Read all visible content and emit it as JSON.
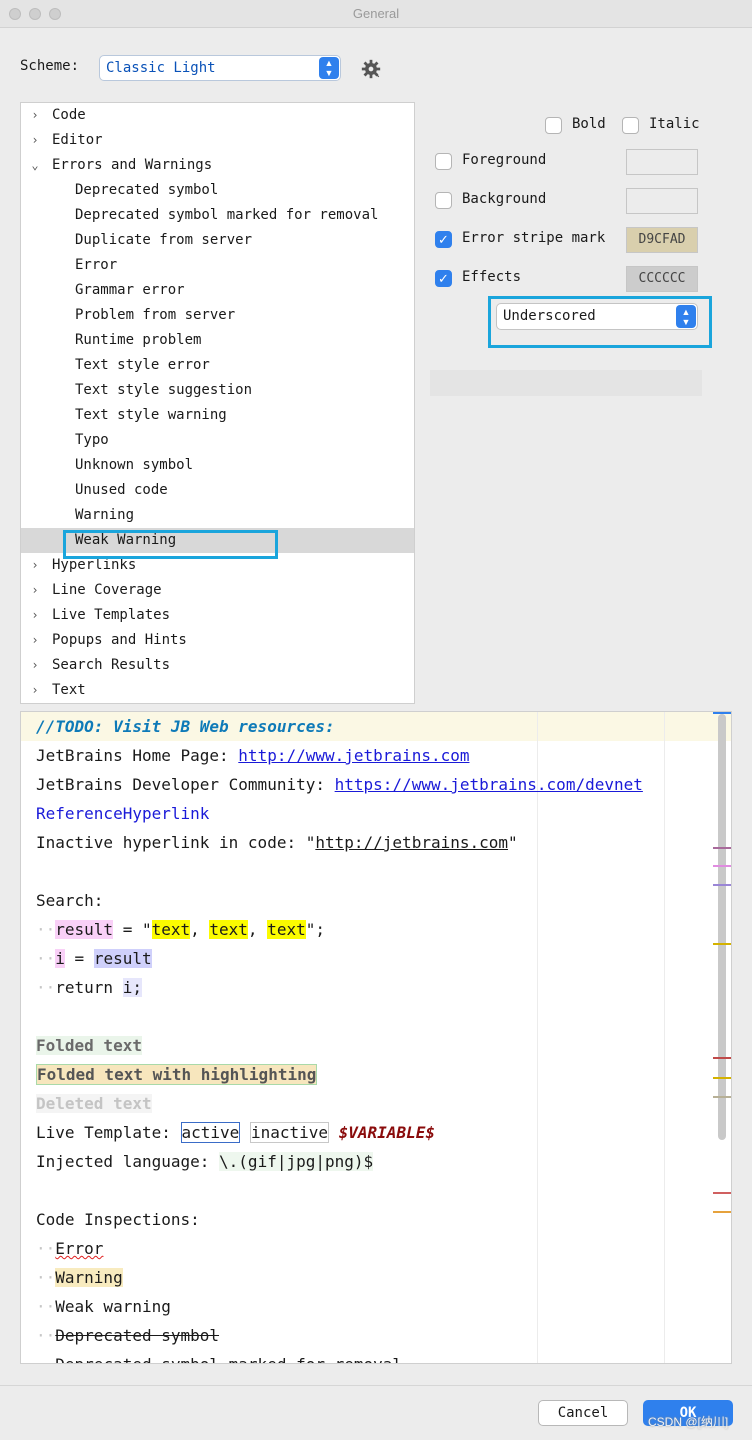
{
  "window": {
    "title": "General"
  },
  "scheme": {
    "label": "Scheme:",
    "value": "Classic Light"
  },
  "tree": {
    "items": [
      {
        "label": "Code",
        "level": 0,
        "chevron": "›"
      },
      {
        "label": "Editor",
        "level": 0,
        "chevron": "›"
      },
      {
        "label": "Errors and Warnings",
        "level": 0,
        "chevron": "⌄"
      },
      {
        "label": "Deprecated symbol",
        "level": 1
      },
      {
        "label": "Deprecated symbol marked for removal",
        "level": 1
      },
      {
        "label": "Duplicate from server",
        "level": 1
      },
      {
        "label": "Error",
        "level": 1
      },
      {
        "label": "Grammar error",
        "level": 1
      },
      {
        "label": "Problem from server",
        "level": 1
      },
      {
        "label": "Runtime problem",
        "level": 1
      },
      {
        "label": "Text style error",
        "level": 1
      },
      {
        "label": "Text style suggestion",
        "level": 1
      },
      {
        "label": "Text style warning",
        "level": 1
      },
      {
        "label": "Typo",
        "level": 1
      },
      {
        "label": "Unknown symbol",
        "level": 1
      },
      {
        "label": "Unused code",
        "level": 1
      },
      {
        "label": "Warning",
        "level": 1
      },
      {
        "label": "Weak Warning",
        "level": 1,
        "selected": true
      },
      {
        "label": "Hyperlinks",
        "level": 0,
        "chevron": "›"
      },
      {
        "label": "Line Coverage",
        "level": 0,
        "chevron": "›"
      },
      {
        "label": "Live Templates",
        "level": 0,
        "chevron": "›"
      },
      {
        "label": "Popups and Hints",
        "level": 0,
        "chevron": "›"
      },
      {
        "label": "Search Results",
        "level": 0,
        "chevron": "›"
      },
      {
        "label": "Text",
        "level": 0,
        "chevron": "›"
      }
    ]
  },
  "options": {
    "bold": {
      "label": "Bold",
      "checked": false
    },
    "italic": {
      "label": "Italic",
      "checked": false
    },
    "foreground": {
      "label": "Foreground",
      "checked": false,
      "color": ""
    },
    "background": {
      "label": "Background",
      "checked": false,
      "color": ""
    },
    "error_stripe": {
      "label": "Error stripe mark",
      "checked": true,
      "color": "D9CFAD"
    },
    "effects": {
      "label": "Effects",
      "checked": true,
      "color": "CCCCCC",
      "type": "Underscored"
    }
  },
  "preview": {
    "todo": "//TODO: Visit JB Web resources:",
    "home_prefix": "JetBrains Home Page: ",
    "home_url": "http://www.jetbrains.com",
    "dev_prefix": "JetBrains Developer Community: ",
    "dev_url": "https://www.jetbrains.com/devnet",
    "ref_link": "ReferenceHyperlink",
    "inactive_prefix": "Inactive hyperlink in code: \"",
    "inactive_url": "http://jetbrains.com",
    "inactive_suffix": "\"",
    "search": "Search:",
    "result": "result",
    "equals_quote": " = \"",
    "text": "text",
    "comma": ", ",
    "end_quote": "\";",
    "i_var": "i",
    "equals": " = ",
    "return_kw": "return ",
    "i_semi": "i;",
    "folded": "Folded text",
    "folded_hl": "Folded text with highlighting",
    "deleted": "Deleted text",
    "live_prefix": "Live Template: ",
    "active": "active",
    "inactive": "inactive",
    "variable": "$VARIABLE$",
    "inj_prefix": "Injected language: ",
    "inj_regex": "\\.(gif|jpg|png)$",
    "inspections": "Code Inspections:",
    "insp_error": "Error",
    "insp_warning": "Warning",
    "insp_weak": "Weak warning",
    "insp_deprecated": "Deprecated symbol",
    "insp_removal": "Deprecated symbol marked for removal",
    "mark_colors": [
      "#a86a9b",
      "#e08ce0",
      "#9a86d6",
      "#d4b200",
      "#c04a4a",
      "#d4b200",
      "#b7b096",
      "#d06060",
      "#e6a23c"
    ],
    "accent": "#2f80ed"
  },
  "footer": {
    "cancel": "Cancel",
    "ok": "OK",
    "watermark": "CSDN @[纳川]"
  }
}
